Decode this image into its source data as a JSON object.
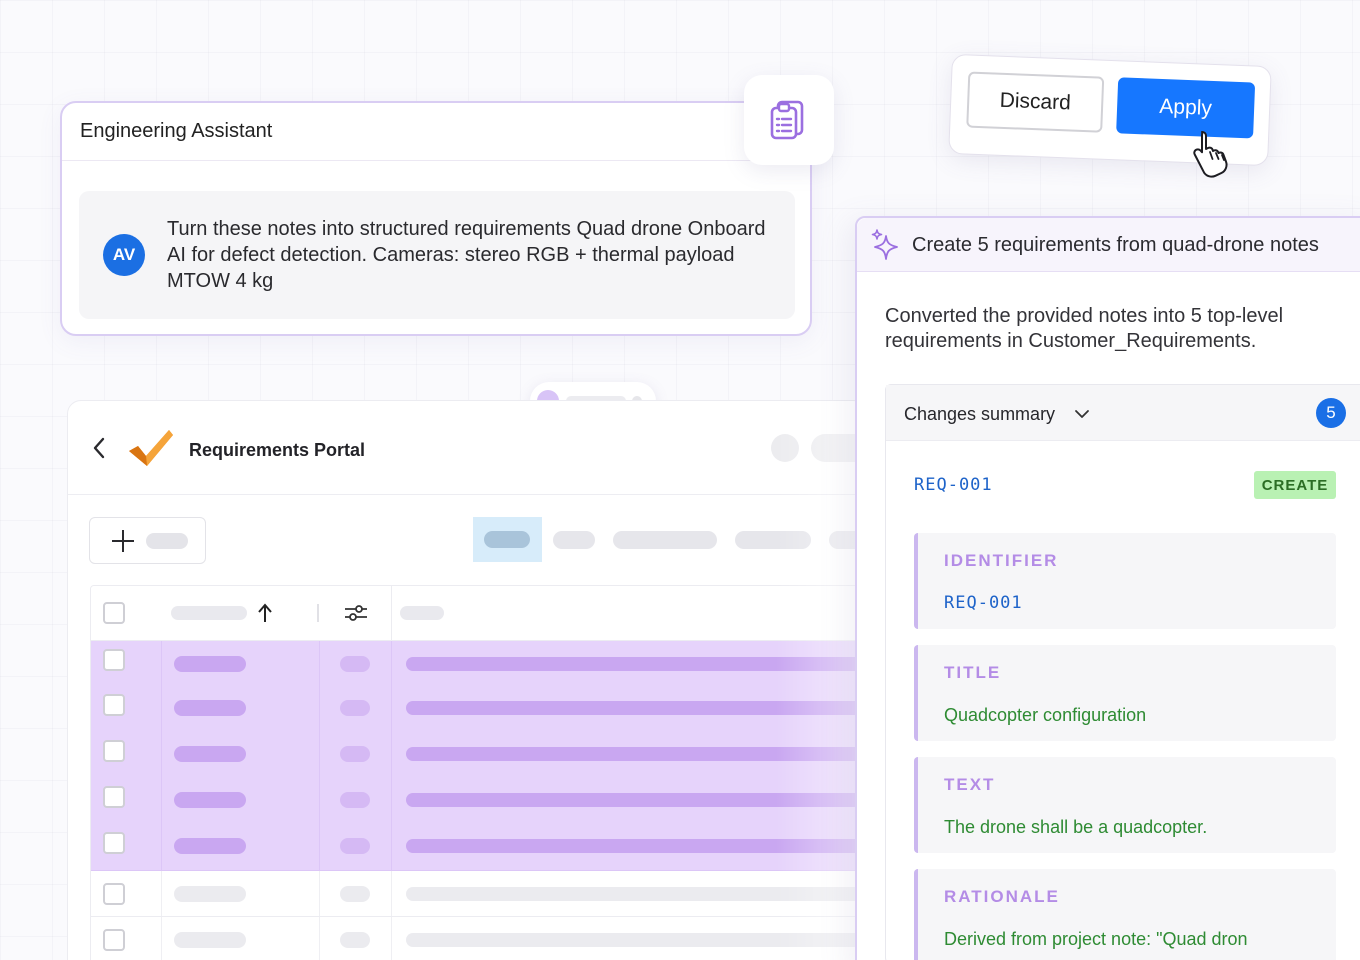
{
  "assistant": {
    "title": "Engineering Assistant",
    "avatar_initials": "AV",
    "message": "Turn these notes into structured requirements Quad drone Onboard AI for defect detection. Cameras: stereo RGB + thermal payload MTOW 4 kg",
    "clipboard_icon": "clipboard-icon"
  },
  "actions": {
    "discard_label": "Discard",
    "apply_label": "Apply",
    "cursor_icon": "hand-pointer-icon"
  },
  "portal": {
    "title": "Requirements Portal",
    "back_icon": "chevron-left-icon",
    "logo_icon": "checkmark-logo-icon",
    "add_icon": "plus-icon",
    "sort_icon": "arrow-up-icon",
    "filter_icon": "sliders-icon"
  },
  "summary": {
    "title": "Create 5 requirements from quad-drone notes",
    "description": "Converted the provided notes into 5 top-level requirements in Customer_Requirements.",
    "changes_label": "Changes summary",
    "changes_count": "5",
    "requirement": {
      "id": "REQ-001",
      "action": "CREATE",
      "fields": [
        {
          "label": "IDENTIFIER",
          "value": "REQ-001"
        },
        {
          "label": "TITLE",
          "value": "Quadcopter configuration"
        },
        {
          "label": "TEXT",
          "value": "The drone shall be a quadcopter."
        },
        {
          "label": "RATIONALE",
          "value": "Derived from project note: \"Quad dron"
        }
      ]
    }
  },
  "colors": {
    "accent_blue": "#1677ff",
    "selection_purple": "#e6d3fb",
    "panel_border": "#d9cdf3",
    "create_green": "#b9f1b3"
  }
}
